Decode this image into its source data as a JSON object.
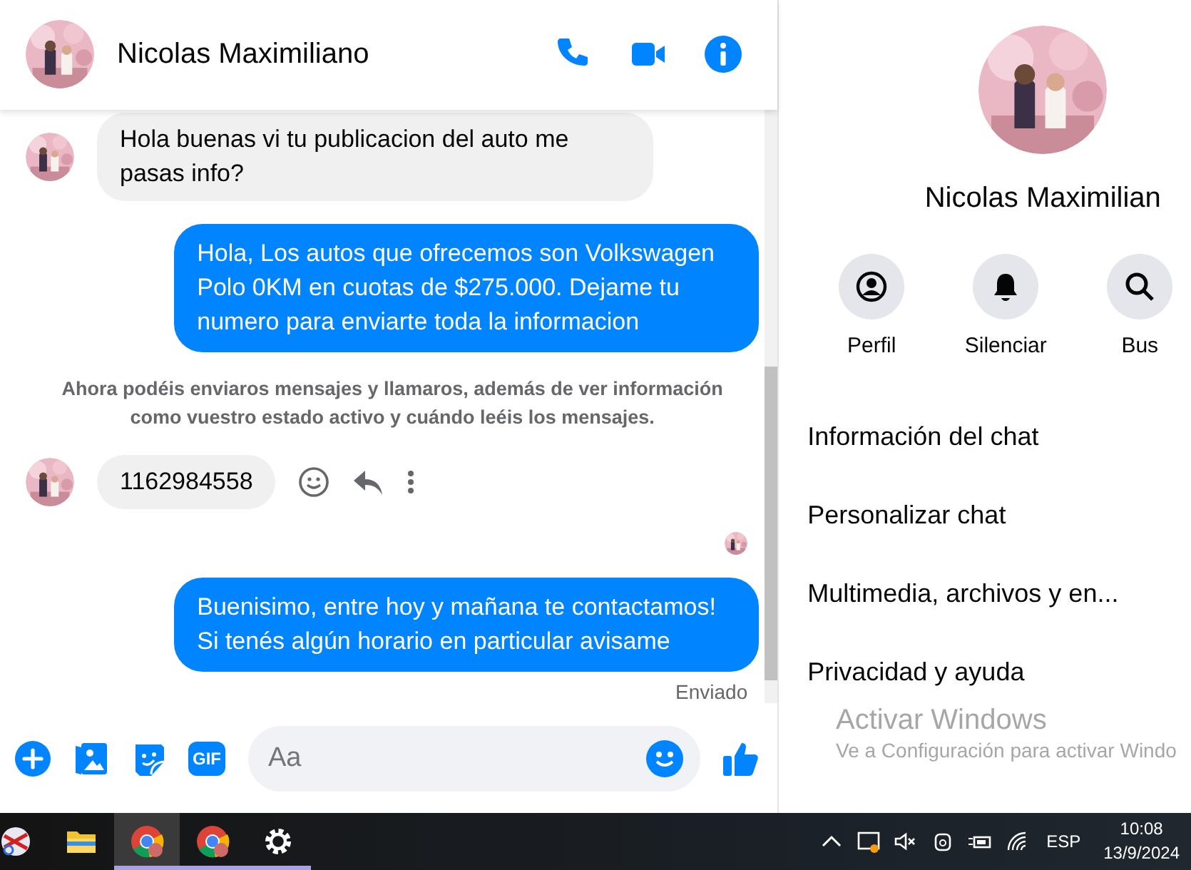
{
  "contact": {
    "name": "Nicolas Maximiliano"
  },
  "messages": [
    {
      "kind": "received",
      "text": "Hola buenas vi tu publicacion del auto me pasas info?",
      "hovered": false
    },
    {
      "kind": "sent",
      "text": "Hola, Los autos que ofrecemos son Volkswagen Polo 0KM en cuotas de $275.000. Dejame tu numero para enviarte toda la informacion"
    },
    {
      "kind": "notice",
      "text": "Ahora podéis enviaros mensajes y llamaros, además de ver información como vuestro estado activo y cuándo leéis los mensajes."
    },
    {
      "kind": "received",
      "text": "1162984558",
      "hovered": true
    },
    {
      "kind": "read_receipt"
    },
    {
      "kind": "sent",
      "text": "Buenisimo, entre hoy y mañana te contactamos! Si tenés algún horario en particular avisame",
      "status": "Enviado"
    }
  ],
  "composer": {
    "placeholder": "Aa",
    "gif_label": "GIF"
  },
  "profile": {
    "name": "Nicolas Maximilian",
    "actions": [
      {
        "label": "Perfil"
      },
      {
        "label": "Silenciar"
      },
      {
        "label": "Bus"
      }
    ],
    "menu": [
      "Información del chat",
      "Personalizar chat",
      "Multimedia, archivos y en...",
      "Privacidad y ayuda"
    ]
  },
  "activation": {
    "title": "Activar Windows",
    "subtitle": "Ve a Configuración para activar Windo"
  },
  "taskbar": {
    "apps": [
      {
        "kind": "snip",
        "selected": false,
        "running": false
      },
      {
        "kind": "folder",
        "selected": false,
        "running": false
      },
      {
        "kind": "chrome",
        "selected": true,
        "running": true
      },
      {
        "kind": "chrome",
        "selected": false,
        "running": true
      },
      {
        "kind": "gear",
        "selected": false,
        "running": true
      }
    ],
    "language": "ESP",
    "time": "10:08",
    "date": "13/9/2024"
  }
}
